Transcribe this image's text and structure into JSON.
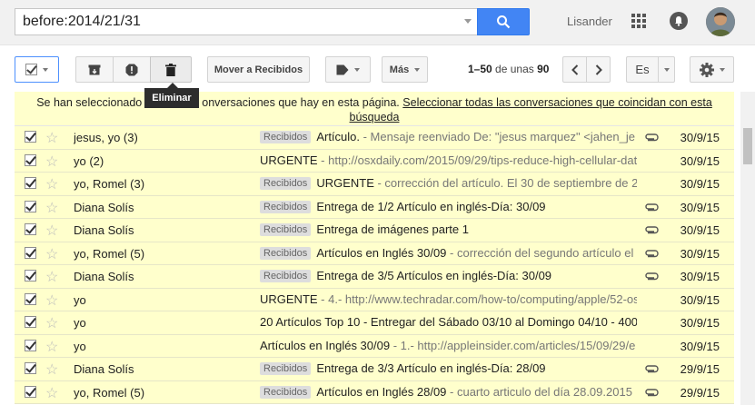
{
  "search": {
    "value": "before:2014/21/31"
  },
  "header": {
    "user_name": "Lisander"
  },
  "toolbar": {
    "move_label": "Mover a Recibidos",
    "more_label": "Más",
    "pagination_range": "1–50",
    "pagination_mid": " de unas ",
    "pagination_total": "90",
    "lang_label": "Es",
    "delete_tooltip": "Eliminar"
  },
  "banner": {
    "text_before": "Se han seleccionado",
    "text_after": "onversaciones que hay en esta página.",
    "link": "Seleccionar todas las conversaciones que coincidan con esta búsqueda"
  },
  "messages": [
    {
      "sender": "jesus, yo (3)",
      "label": "Recibidos",
      "subject": "Artículo.",
      "snippet": " - Mensaje reenviado De: \"jesus marquez\" <jahen_je",
      "attachment": true,
      "date": "30/9/15"
    },
    {
      "sender": "yo (2)",
      "label": "",
      "subject": "URGENTE",
      "snippet": " - http://osxdaily.com/2015/09/29/tips-reduce-high-cellular-data",
      "attachment": false,
      "date": "30/9/15"
    },
    {
      "sender": "yo, Romel (3)",
      "label": "Recibidos",
      "subject": "URGENTE",
      "snippet": " - corrección del artículo. El 30 de septiembre de 2",
      "attachment": false,
      "date": "30/9/15"
    },
    {
      "sender": "Diana Solís",
      "label": "Recibidos",
      "subject": "Entrega de 1/2 Artículo en inglés-Día: 30/09",
      "snippet": "",
      "attachment": true,
      "date": "30/9/15"
    },
    {
      "sender": "Diana Solís",
      "label": "Recibidos",
      "subject": "Entrega de imágenes parte 1",
      "snippet": "",
      "attachment": true,
      "date": "30/9/15"
    },
    {
      "sender": "yo, Romel (5)",
      "label": "Recibidos",
      "subject": "Artículos en Inglés 30/09",
      "snippet": " - corrección del segundo artículo el",
      "attachment": true,
      "date": "30/9/15"
    },
    {
      "sender": "Diana Solís",
      "label": "Recibidos",
      "subject": "Entrega de 3/5 Artículos en inglés-Día: 30/09",
      "snippet": "",
      "attachment": true,
      "date": "30/9/15"
    },
    {
      "sender": "yo",
      "label": "",
      "subject": "URGENTE",
      "snippet": " - 4.- http://www.techradar.com/how-to/computing/apple/52-os",
      "attachment": false,
      "date": "30/9/15"
    },
    {
      "sender": "yo",
      "label": "",
      "subject": "20 Artículos Top 10 - Entregar del Sábado 03/10 al Domingo 04/10 - 400",
      "snippet": "",
      "attachment": false,
      "date": "30/9/15"
    },
    {
      "sender": "yo",
      "label": "",
      "subject": "Artículos en Inglés 30/09",
      "snippet": " - 1.- http://appleinsider.com/articles/15/09/29/e",
      "attachment": false,
      "date": "30/9/15"
    },
    {
      "sender": "Diana Solís",
      "label": "Recibidos",
      "subject": "Entrega de 3/3 Artículo en inglés-Día: 28/09",
      "snippet": "",
      "attachment": true,
      "date": "29/9/15"
    },
    {
      "sender": "yo, Romel (5)",
      "label": "Recibidos",
      "subject": "Artículos en Inglés 28/09",
      "snippet": " - cuarto articulo del día 28.09.2015",
      "attachment": true,
      "date": "29/9/15"
    }
  ]
}
